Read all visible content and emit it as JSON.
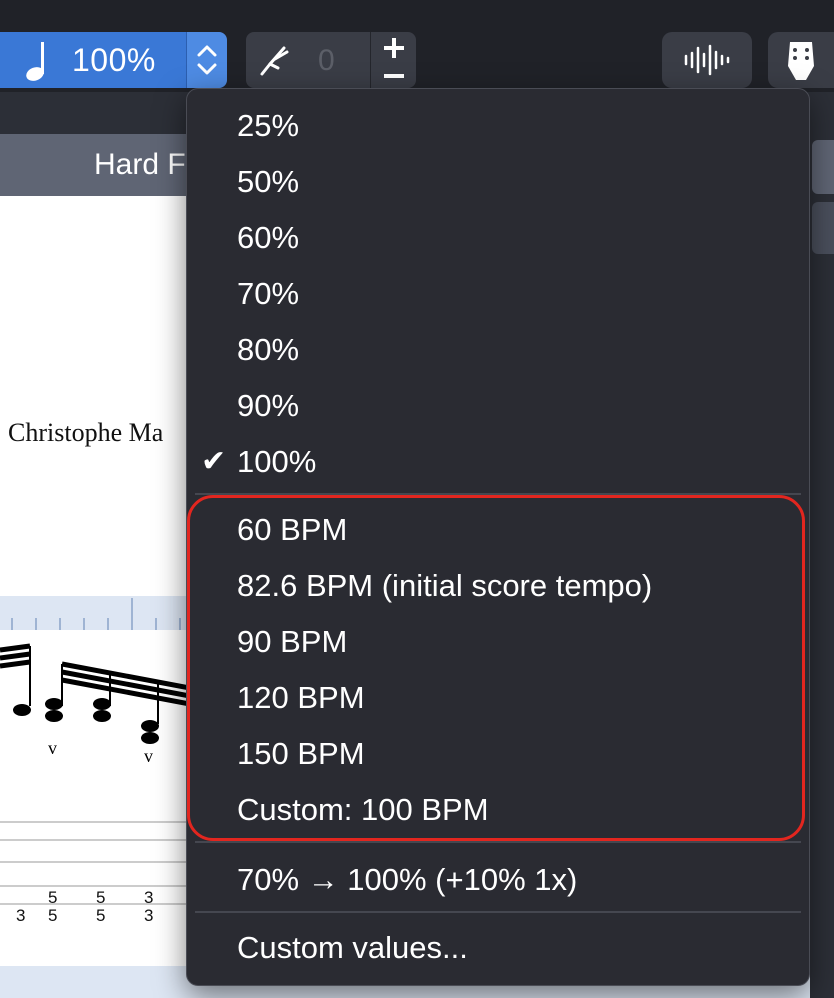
{
  "toolbar": {
    "tempo_value": "100%",
    "transpose_value": "0",
    "colors": {
      "accent": "#3a78d6",
      "menu_bg": "#2a2b32",
      "highlight": "#e2261f"
    }
  },
  "score": {
    "header_title": "Hard F",
    "composer": "Christophe Ma",
    "tab_digits": [
      "3",
      "5",
      "5",
      "5",
      "5",
      "3",
      "3"
    ]
  },
  "menu": {
    "percent_items": [
      "25%",
      "50%",
      "60%",
      "70%",
      "80%",
      "90%",
      "100%"
    ],
    "selected": "100%",
    "bpm_items": [
      "60 BPM",
      "82.6 BPM (initial score tempo)",
      "90 BPM",
      "120 BPM",
      "150 BPM",
      "Custom: 100 BPM"
    ],
    "progressive": "70% → 100% (+10% 1x)",
    "custom_values": "Custom values..."
  },
  "icons": [
    "quarter-note-icon",
    "stepper-chevrons-icon",
    "tuning-fork-icon",
    "plus-icon",
    "minus-icon",
    "audio-waveform-icon",
    "guitar-headstock-icon",
    "checkmark-icon"
  ]
}
